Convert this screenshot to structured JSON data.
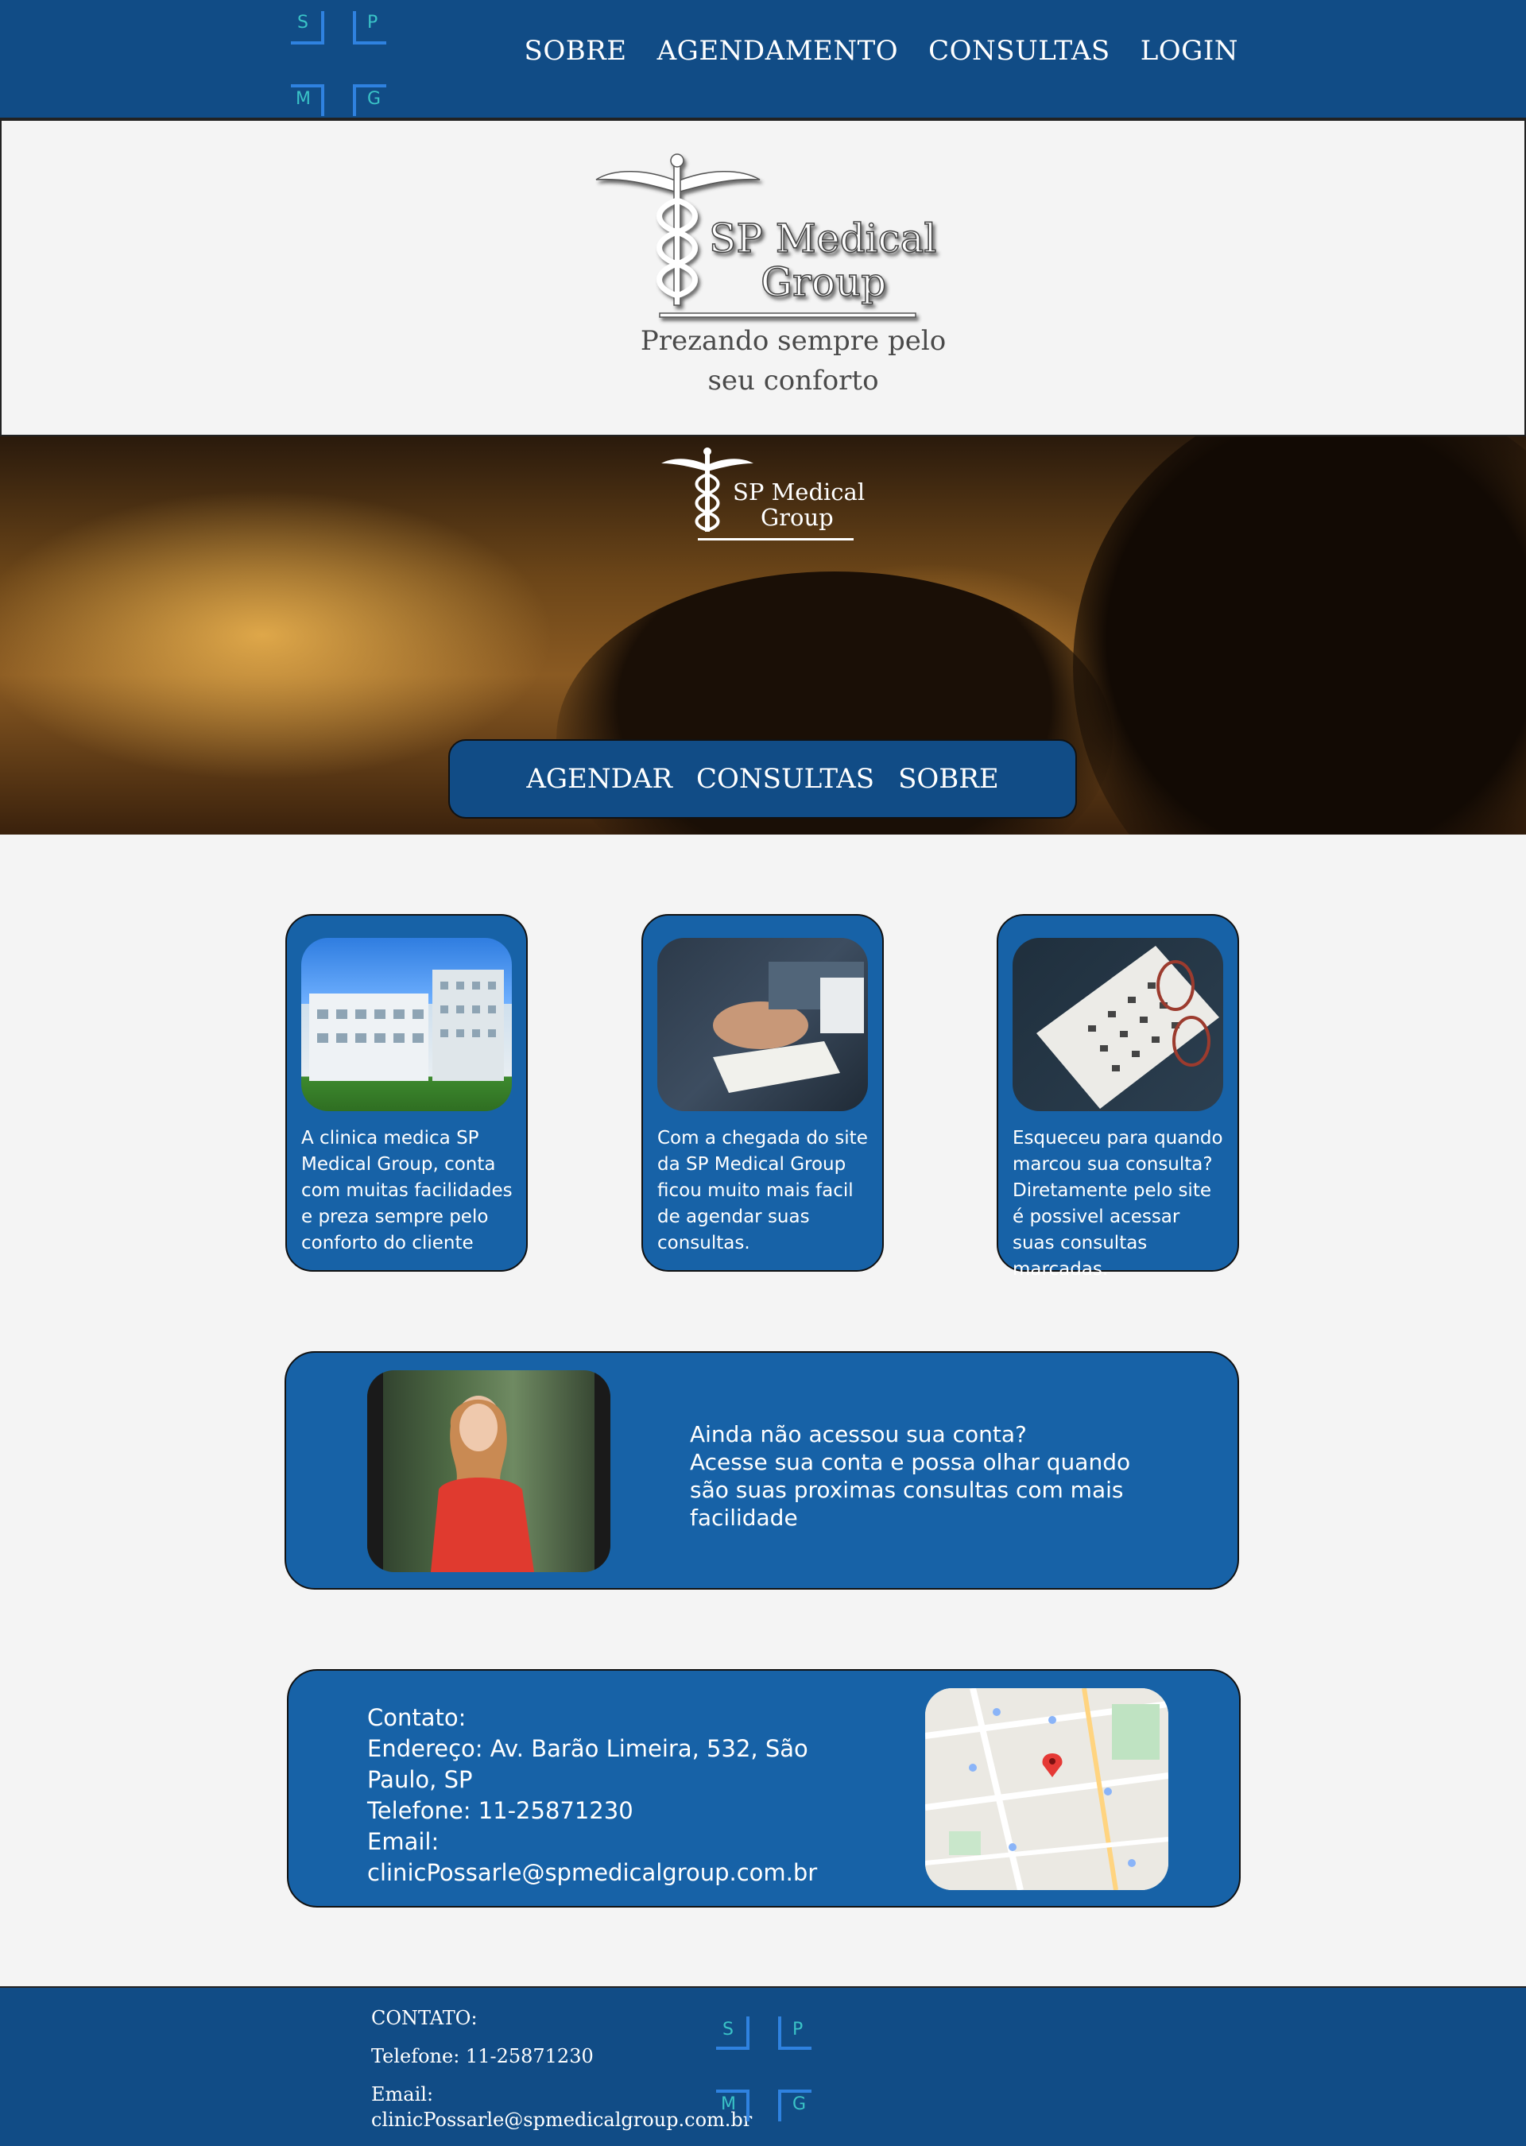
{
  "header": {
    "logo": {
      "s": "S",
      "p": "P",
      "m": "M",
      "g": "G"
    },
    "nav": [
      "SOBRE",
      "AGENDAMENTO",
      "CONSULTAS",
      "LOGIN"
    ]
  },
  "hero": {
    "brand_line1": "SP Medical",
    "brand_line2": "Group",
    "tagline_line1": "Prezando sempre pelo",
    "tagline_line2": "seu conforto"
  },
  "banner": {
    "brand_line1": "SP Medical",
    "brand_line2": "Group",
    "nav": [
      "AGENDAR",
      "CONSULTAS",
      "SOBRE"
    ]
  },
  "cards": [
    {
      "text": "A clinica medica SP Medical Group, conta com muitas facilidades e preza sempre pelo conforto do cliente"
    },
    {
      "text": "Com a chegada do site da SP Medical Group ficou muito mais facil de agendar suas consultas."
    },
    {
      "text": "Esqueceu para quando marcou sua consulta? Diretamente pelo site é possivel acessar suas consultas marcadas."
    }
  ],
  "account": {
    "line1": "Ainda não acessou sua conta?",
    "line2": "Acesse sua conta e possa olhar quando são suas proximas consultas com mais facilidade"
  },
  "contact": {
    "title": "Contato:",
    "address": "Endereço: Av. Barão Limeira, 532, São Paulo, SP",
    "phone": "Telefone: 11-25871230",
    "email": "Email: clinicPossarle@spmedicalgroup.com.br"
  },
  "footer": {
    "title": "CONTATO:",
    "phone": "Telefone: 11-25871230",
    "email_label": "Email:",
    "email": "clinicPossarle@spmedicalgroup.com.br",
    "logo": {
      "s": "S",
      "p": "P",
      "m": "M",
      "g": "G"
    }
  },
  "colors": {
    "primary": "#114c86",
    "card": "#1762a7",
    "accent_line": "#2f82e0",
    "accent_letter": "#3ac3c7",
    "page_bg": "#f4f4f4"
  }
}
